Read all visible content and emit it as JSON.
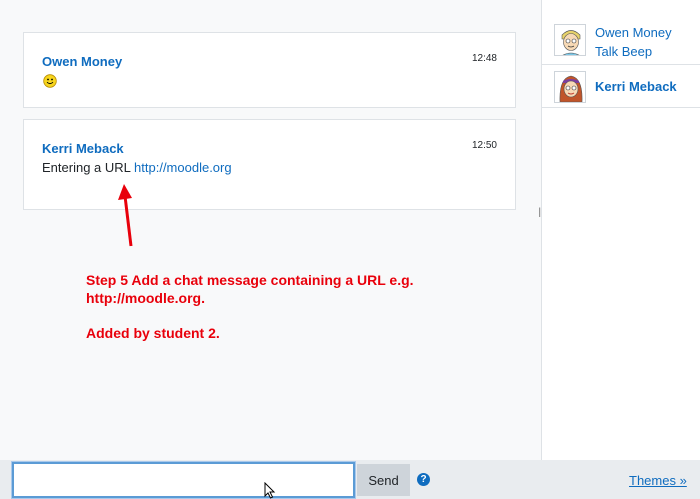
{
  "messages": [
    {
      "author": "Owen Money",
      "time": "12:48",
      "content_type": "smiley",
      "smiley_icon": "smiley-face-icon"
    },
    {
      "author": "Kerri Meback",
      "time": "12:50",
      "text_prefix": "Entering a URL",
      "link": "http://moodle.org"
    }
  ],
  "users": [
    {
      "name": "Owen Money",
      "action": "Talk",
      "beep": "Beep"
    },
    {
      "name": "Kerri Meback"
    }
  ],
  "annotation": {
    "line1": "Step 5 Add a chat message containing a URL e.g.",
    "line2": "http://moodle.org.",
    "line3": "Added by student 2.",
    "color": "#e8000b"
  },
  "input": {
    "value": "",
    "placeholder": ""
  },
  "send_label": "Send",
  "help_symbol": "?",
  "themes_label": "Themes »",
  "colors": {
    "link": "#0f6cbf",
    "background": "#f8f9fa"
  }
}
